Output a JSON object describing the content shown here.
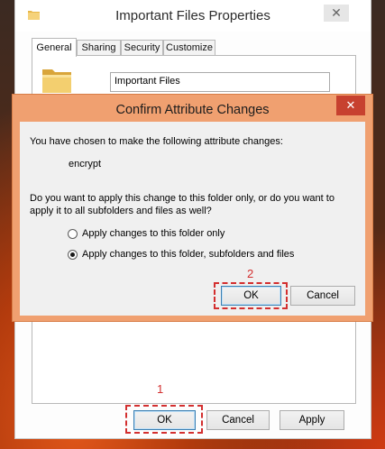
{
  "properties_window": {
    "title": "Important Files Properties",
    "close_glyph": "✕",
    "tabs": [
      "General",
      "Sharing",
      "Security",
      "Customize"
    ],
    "folder_name": "Important Files",
    "buttons": {
      "ok": "OK",
      "cancel": "Cancel",
      "apply": "Apply"
    },
    "annotation": "1"
  },
  "dialog": {
    "title": "Confirm Attribute Changes",
    "close_glyph": "✕",
    "intro": "You have chosen to make the following attribute changes:",
    "attribute": "encrypt",
    "question": "Do you want to apply this change to this folder only, or do you want to apply it to all subfolders and files as well?",
    "options": [
      {
        "label": "Apply changes to this folder only",
        "selected": false
      },
      {
        "label": "Apply changes to this folder, subfolders and files",
        "selected": true
      }
    ],
    "buttons": {
      "ok": "OK",
      "cancel": "Cancel"
    },
    "annotation": "2"
  },
  "colors": {
    "dialog_frame": "#f0a070",
    "annotation": "#d32f2f",
    "close_red": "#c7412f"
  },
  "icons": [
    "folder-icon",
    "close-icon",
    "radio-icon"
  ]
}
